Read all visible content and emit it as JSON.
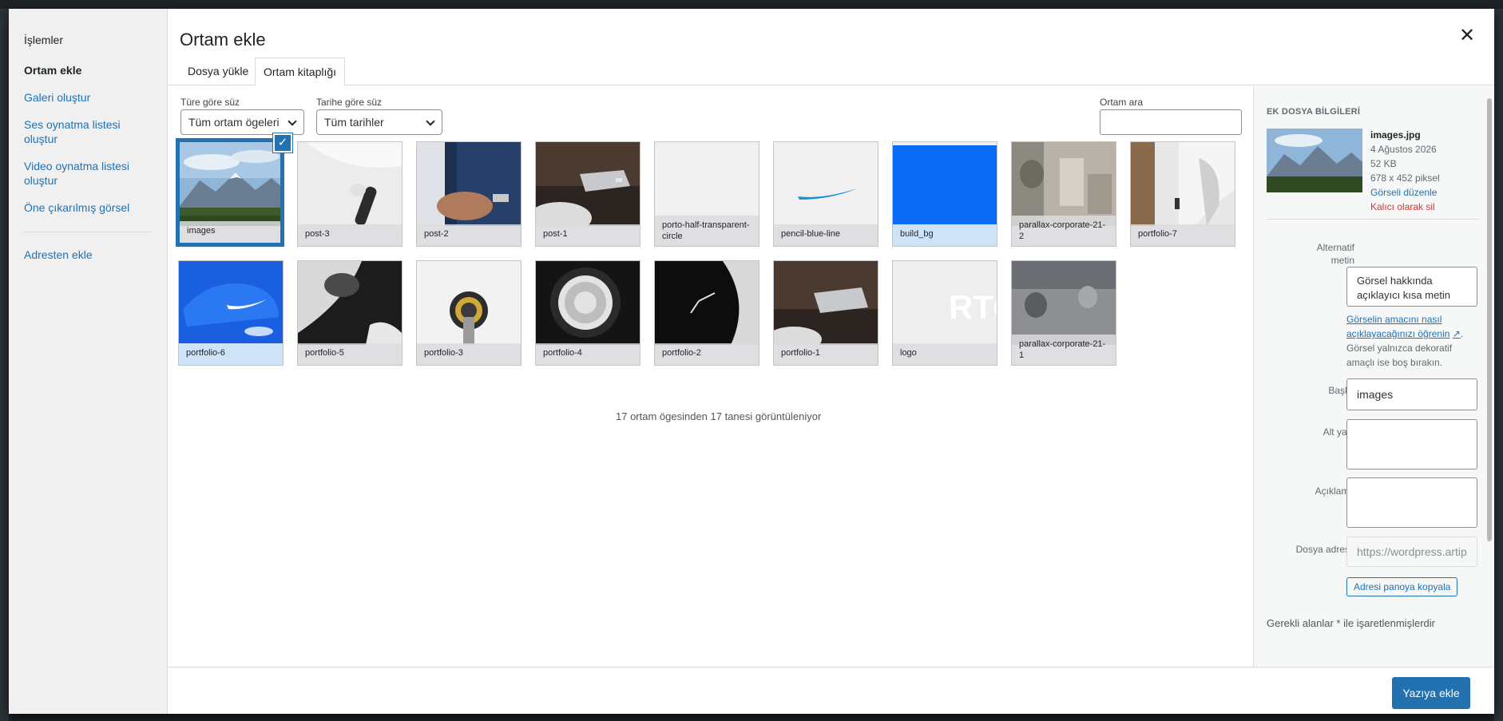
{
  "modal": {
    "title": "Ortam ekle",
    "close_symbol": "✕"
  },
  "menu": {
    "heading": "İşlemler",
    "items": [
      {
        "label": "Ortam ekle"
      },
      {
        "label": "Galeri oluştur"
      },
      {
        "label": "Ses oynatma listesi oluştur"
      },
      {
        "label": "Video oynatma listesi oluştur"
      },
      {
        "label": "Öne çıkarılmış görsel"
      },
      {
        "label": "Adresten ekle"
      }
    ]
  },
  "tabs": [
    {
      "label": "Dosya yükle"
    },
    {
      "label": "Ortam kitaplığı"
    }
  ],
  "filters": {
    "type_label": "Türe göre süz",
    "type_value": "Tüm ortam ögeleri",
    "date_label": "Tarihe göre süz",
    "date_value": "Tüm tarihler",
    "search_label": "Ortam ara",
    "search_value": ""
  },
  "media": [
    {
      "name": "images"
    },
    {
      "name": "post-3"
    },
    {
      "name": "post-2"
    },
    {
      "name": "post-1"
    },
    {
      "name": "porto-half-transparent-circle"
    },
    {
      "name": "pencil-blue-line"
    },
    {
      "name": "build_bg"
    },
    {
      "name": "parallax-corporate-21-2"
    },
    {
      "name": "portfolio-7"
    },
    {
      "name": "portfolio-6"
    },
    {
      "name": "portfolio-5"
    },
    {
      "name": "portfolio-3"
    },
    {
      "name": "portfolio-4"
    },
    {
      "name": "portfolio-2"
    },
    {
      "name": "portfolio-1"
    },
    {
      "name": "logo"
    },
    {
      "name": "parallax-corporate-21-1"
    }
  ],
  "status_text": "17 ortam ögesinden 17 tanesi görüntüleniyor",
  "sidebar": {
    "title": "EK DOSYA BİLGİLERİ",
    "file_name": "images.jpg",
    "date": "4 Ağustos 2026",
    "size": "52 KB",
    "dimensions": "678 x 452 piksel",
    "edit_link": "Görseli düzenle",
    "delete_link": "Kalıcı olarak sil",
    "alt_label": "Alternatif metin",
    "alt_value": "Görsel hakkında açıklayıcı kısa metin",
    "alt_help_link": "Görselin amacını nasıl açıklayacağınızı öğrenin",
    "alt_help_text": "Görsel yalnızca dekoratif amaçlı ise boş bırakın.",
    "title_label": "Başlık",
    "title_value": "images",
    "caption_label": "Alt yazı",
    "caption_value": "",
    "description_label": "Açıklama",
    "description_value": "",
    "url_label": "Dosya adresi:",
    "url_value": "https://wordpress.artip",
    "copy_button": "Adresi panoya kopyala",
    "required_note": "Gerekli alanlar * ile işaretlenmişlerdir"
  },
  "footer": {
    "insert_button": "Yazıya ekle"
  },
  "colors": {
    "accent": "#2271b1",
    "delete": "#d63638"
  }
}
